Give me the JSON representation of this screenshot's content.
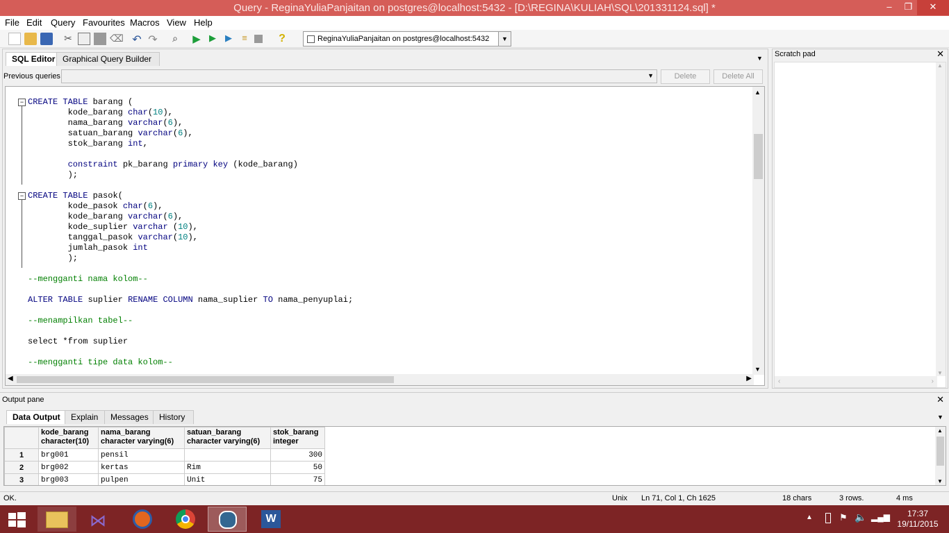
{
  "window": {
    "title": "Query - ReginaYuliaPanjaitan on postgres@localhost:5432 - [D:\\REGINA\\KULIAH\\SQL\\201331124.sql] *",
    "minimize": "–",
    "maximize": "❐",
    "close": "✕"
  },
  "menu": [
    "File",
    "Edit",
    "Query",
    "Favourites",
    "Macros",
    "View",
    "Help"
  ],
  "connection": {
    "label": "ReginaYuliaPanjaitan on postgres@localhost:5432"
  },
  "editor_tabs": {
    "sql_editor": "SQL Editor",
    "gqb": "Graphical Query Builder"
  },
  "previous_queries": {
    "label": "Previous queries",
    "delete": "Delete",
    "delete_all": "Delete All"
  },
  "scratch_pad": {
    "title": "Scratch pad"
  },
  "code": [
    {
      "t": "CREATE TABLE barang (",
      "fold": true
    },
    {
      "t": "        kode_barang char(10),"
    },
    {
      "t": "        nama_barang varchar(6),"
    },
    {
      "t": "        satuan_barang varchar(6),"
    },
    {
      "t": "        stok_barang int,"
    },
    {
      "t": ""
    },
    {
      "t": "        constraint pk_barang primary key (kode_barang)"
    },
    {
      "t": "        );"
    },
    {
      "t": ""
    },
    {
      "t": "CREATE TABLE pasok(",
      "fold": true
    },
    {
      "t": "        kode_pasok char(6),"
    },
    {
      "t": "        kode_barang varchar(6),"
    },
    {
      "t": "        kode_suplier varchar (10),"
    },
    {
      "t": "        tanggal_pasok varchar(10),"
    },
    {
      "t": "        jumlah_pasok int"
    },
    {
      "t": "        );"
    },
    {
      "t": ""
    },
    {
      "t": "--mengganti nama kolom--",
      "cm": true
    },
    {
      "t": ""
    },
    {
      "t": "ALTER TABLE suplier RENAME COLUMN nama_suplier TO nama_penyuplai;"
    },
    {
      "t": ""
    },
    {
      "t": "--menampilkan tabel--",
      "cm": true
    },
    {
      "t": ""
    },
    {
      "t": "select *from suplier"
    },
    {
      "t": ""
    },
    {
      "t": "--mengganti tipe data kolom--",
      "cm": true
    }
  ],
  "output": {
    "title": "Output pane",
    "tabs": [
      "Data Output",
      "Explain",
      "Messages",
      "History"
    ],
    "columns": [
      {
        "name": "kode_barang",
        "type": "character(10)"
      },
      {
        "name": "nama_barang",
        "type": "character varying(6)"
      },
      {
        "name": "satuan_barang",
        "type": "character varying(6)"
      },
      {
        "name": "stok_barang",
        "type": "integer"
      }
    ],
    "rows": [
      {
        "n": "1",
        "c": [
          "brg001",
          "pensil",
          "",
          "300"
        ]
      },
      {
        "n": "2",
        "c": [
          "brg002",
          "kertas",
          "Rim",
          "50"
        ]
      },
      {
        "n": "3",
        "c": [
          "brg003",
          "pulpen",
          "Unit",
          "75"
        ]
      }
    ]
  },
  "status": {
    "msg": "OK.",
    "eol": "Unix",
    "pos": "Ln 71, Col 1, Ch 1625",
    "chars": "18 chars",
    "rows": "3 rows.",
    "time": "4 ms"
  },
  "clock": {
    "time": "17:37",
    "date": "19/11/2015"
  }
}
